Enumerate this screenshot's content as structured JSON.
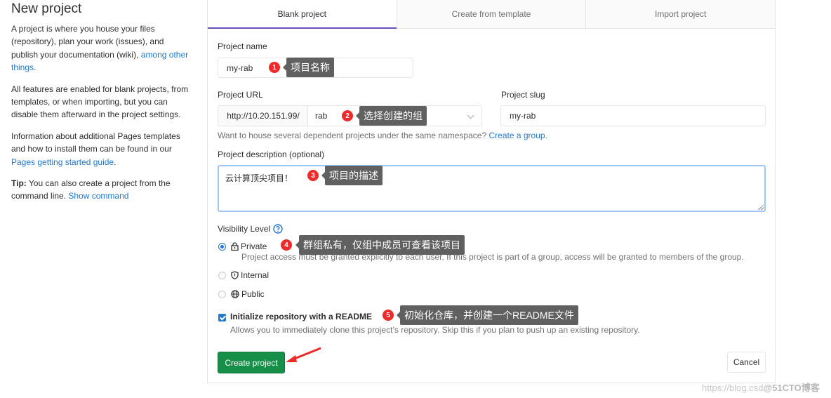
{
  "sidebar": {
    "title": "New project",
    "para1_text": "A project is where you house your files (repository), plan your work (issues), and publish your documentation (wiki),",
    "para1_link": "among other things",
    "para2": "All features are enabled for blank projects, from templates, or when importing, but you can disable them afterward in the project settings.",
    "para3_text": "Information about additional Pages templates and how to install them can be found in our",
    "para3_link": "Pages getting started guide",
    "tip_label": "Tip:",
    "tip_text": "You can also create a project from the command line.",
    "tip_link": "Show command"
  },
  "tabs": [
    {
      "label": "Blank project",
      "active": true
    },
    {
      "label": "Create from template",
      "active": false
    },
    {
      "label": "Import project",
      "active": false
    }
  ],
  "form": {
    "project_name_label": "Project name",
    "project_name_value": "my-rab",
    "project_url_label": "Project URL",
    "project_url_prefix": "http://10.20.151.99/",
    "namespace_value": "rab",
    "project_slug_label": "Project slug",
    "project_slug_value": "my-rab",
    "namespace_help": "Want to house several dependent projects under the same namespace?",
    "namespace_help_link": "Create a group.",
    "description_label": "Project description (optional)",
    "description_value": "云计算顶尖项目！",
    "visibility_label": "Visibility Level",
    "visibility_options": [
      {
        "label": "Private",
        "icon": "lock-icon",
        "selected": true,
        "description": "Project access must be granted explicitly to each user. If this project is part of a group, access will be granted to members of the group."
      },
      {
        "label": "Internal",
        "icon": "shield-icon",
        "selected": false
      },
      {
        "label": "Public",
        "icon": "globe-icon",
        "selected": false
      }
    ],
    "readme_label": "Initialize repository with a README",
    "readme_checked": true,
    "readme_help": "Allows you to immediately clone this project’s repository. Skip this if you plan to push up an existing repository.",
    "create_button": "Create project",
    "cancel_button": "Cancel"
  },
  "annotations": [
    {
      "number": "1",
      "text": "项目名称"
    },
    {
      "number": "2",
      "text": "选择创建的组"
    },
    {
      "number": "3",
      "text": "项目的描述"
    },
    {
      "number": "4",
      "text": "群组私有，仅组中成员可查看该项目"
    },
    {
      "number": "5",
      "text": "初始化仓库，并创建一个README文件"
    }
  ],
  "colors": {
    "link": "#1f78d1",
    "active_tab_border": "#6b4fbb",
    "create_button": "#168f48",
    "annotation_badge": "#ee2a2a",
    "annotation_note": "#606060"
  },
  "watermark": {
    "url_text": "https://blog.csd",
    "brand_text": "@51CTO博客"
  }
}
